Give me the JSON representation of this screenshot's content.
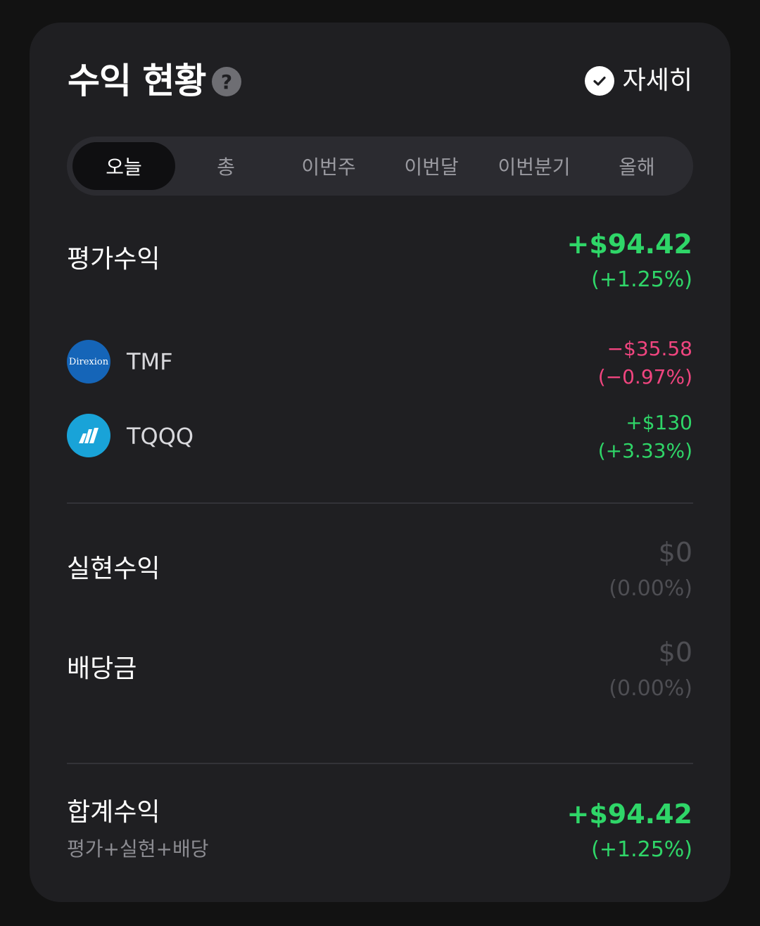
{
  "header": {
    "title": "수익 현황",
    "help_icon": "?",
    "detail_label": "자세히"
  },
  "tabs": [
    {
      "label": "오늘",
      "active": true
    },
    {
      "label": "총",
      "active": false
    },
    {
      "label": "이번주",
      "active": false
    },
    {
      "label": "이번달",
      "active": false
    },
    {
      "label": "이번분기",
      "active": false
    },
    {
      "label": "올해",
      "active": false
    }
  ],
  "unrealized": {
    "label": "평가수익",
    "amount": "+$94.42",
    "percent": "(+1.25%)"
  },
  "holdings": [
    {
      "logo_text": "Direxion",
      "ticker": "TMF",
      "amount": "−$35.58",
      "percent": "(−0.97%)",
      "trend": "down"
    },
    {
      "logo_text": "",
      "ticker": "TQQQ",
      "amount": "+$130",
      "percent": "(+3.33%)",
      "trend": "up"
    }
  ],
  "realized": {
    "label": "실현수익",
    "amount": "$0",
    "percent": "(0.00%)"
  },
  "dividend": {
    "label": "배당금",
    "amount": "$0",
    "percent": "(0.00%)"
  },
  "total": {
    "label": "합계수익",
    "sublabel": "평가+실현+배당",
    "amount": "+$94.42",
    "percent": "(+1.25%)"
  },
  "colors": {
    "positive": "#2fd668",
    "negative": "#f0457f",
    "muted": "#4e4e53",
    "card_bg": "#1f1f22"
  }
}
